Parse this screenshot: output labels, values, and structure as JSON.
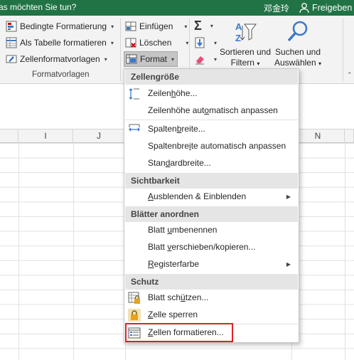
{
  "titlebar": {
    "tell_me": "as möchten Sie tun?",
    "user": "邓金玲",
    "share": "Freigeben"
  },
  "ribbon": {
    "styles_group": {
      "conditional": "Bedingte Formatierung",
      "as_table": "Als Tabelle formatieren",
      "cell_styles": "Zellenformatvorlagen",
      "label": "Formatvorlagen"
    },
    "cells_group": {
      "insert": "Einfügen",
      "delete": "Löschen",
      "format": "Format"
    },
    "editing_group": {
      "sort_line1": "Sortieren und",
      "sort_line2": "Filtern",
      "find_line1": "Suchen und",
      "find_line2": "Auswählen"
    }
  },
  "grid": {
    "columns": [
      "I",
      "J",
      "N"
    ]
  },
  "menu": {
    "sections": [
      {
        "header": "Zellengröße"
      },
      {
        "header": "Sichtbarkeit"
      },
      {
        "header": "Blätter anordnen"
      },
      {
        "header": "Schutz"
      }
    ],
    "items": {
      "row_height": {
        "pre": "Zeilen",
        "u": "h",
        "post": "öhe..."
      },
      "autofit_row": {
        "pre": "Zeilenhöhe aut",
        "u": "o",
        "post": "matisch anpassen"
      },
      "col_width": {
        "pre": "Spalten",
        "u": "b",
        "post": "reite..."
      },
      "autofit_col": {
        "pre": "Spaltenbre",
        "u": "i",
        "post": "te automatisch anpassen"
      },
      "default_width": {
        "pre": "Stan",
        "u": "d",
        "post": "ardbreite..."
      },
      "hide_unhide": {
        "pre": "",
        "u": "A",
        "post": "usblenden & Einblenden"
      },
      "rename": {
        "pre": "Blatt ",
        "u": "u",
        "post": "mbenennen"
      },
      "move_copy": {
        "pre": "Blatt ",
        "u": "v",
        "post": "erschieben/kopieren..."
      },
      "tab_color": {
        "pre": "",
        "u": "R",
        "post": "egisterfarbe"
      },
      "protect_sheet": {
        "pre": "Blatt sch",
        "u": "ü",
        "post": "tzen..."
      },
      "lock_cell": {
        "pre": "",
        "u": "Z",
        "post": "elle sperren"
      },
      "format_cells": {
        "pre": "",
        "u": "Z",
        "post": "ellen formatieren..."
      }
    }
  },
  "colors": {
    "excel_green": "#217346",
    "highlight_red": "#e41e26",
    "ribbon_bg": "#f3f3f3"
  }
}
